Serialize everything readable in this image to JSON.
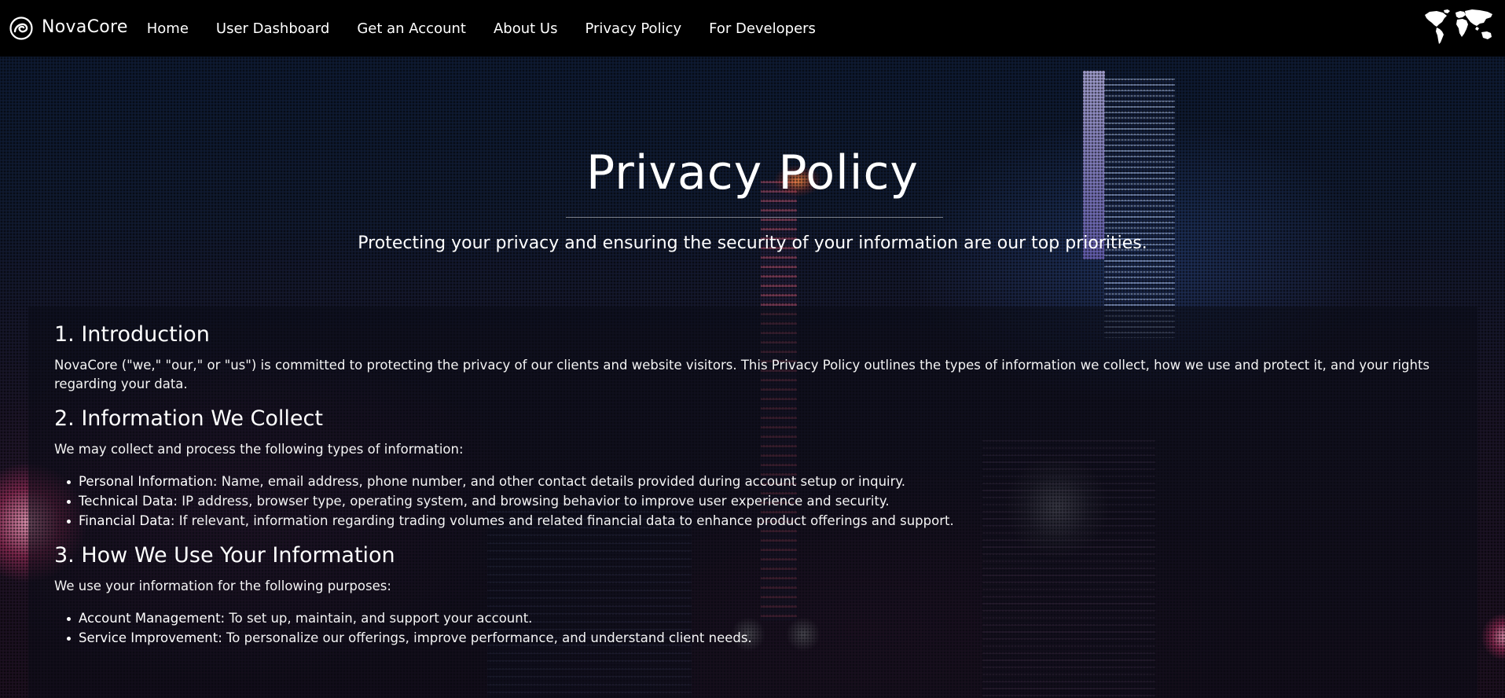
{
  "brand": {
    "name": "NovaCore",
    "logo_icon": "swirl-logo-icon"
  },
  "nav": {
    "items": [
      {
        "label": "Home"
      },
      {
        "label": "User Dashboard"
      },
      {
        "label": "Get an Account"
      },
      {
        "label": "About Us"
      },
      {
        "label": "Privacy Policy"
      },
      {
        "label": "For Developers"
      }
    ],
    "right_icon": "world-map-icon"
  },
  "hero": {
    "title": "Privacy Policy",
    "subtitle": "Protecting your privacy and ensuring the security of your information are our top priorities."
  },
  "sections": [
    {
      "heading": "1. Introduction",
      "body": "NovaCore (\"we,\" \"our,\" or \"us\") is committed to protecting the privacy of our clients and website visitors. This Privacy Policy outlines the types of information we collect, how we use and protect it, and your rights regarding your data."
    },
    {
      "heading": "2. Information We Collect",
      "body": "We may collect and process the following types of information:",
      "items": [
        {
          "term": "Personal Information:",
          "text": " Name, email address, phone number, and other contact details provided during account setup or inquiry."
        },
        {
          "term": "Technical Data:",
          "text": " IP address, browser type, operating system, and browsing behavior to improve user experience and security."
        },
        {
          "term": "Financial Data:",
          "text": " If relevant, information regarding trading volumes and related financial data to enhance product offerings and support."
        }
      ]
    },
    {
      "heading": "3. How We Use Your Information",
      "body": "We use your information for the following purposes:",
      "items": [
        {
          "term": "Account Management:",
          "text": " To set up, maintain, and support your account."
        },
        {
          "term": "Service Improvement:",
          "text": " To personalize our offerings, improve performance, and understand client needs."
        }
      ]
    }
  ],
  "colors": {
    "nav_background": "#000000",
    "text": "#ffffff",
    "panel_background": "rgba(10,12,22,0.58)"
  }
}
